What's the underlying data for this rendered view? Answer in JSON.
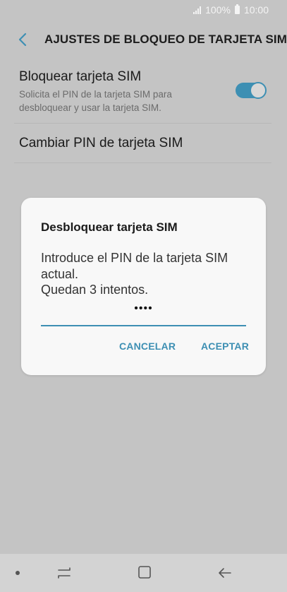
{
  "status_bar": {
    "battery": "100%",
    "time": "10:00",
    "icons": [
      "signal-icon",
      "battery-icon"
    ]
  },
  "header": {
    "back_icon": "chevron-left-icon",
    "title": "AJUSTES DE BLOQUEO DE TARJETA SIM"
  },
  "settings": {
    "lock_sim": {
      "title": "Bloquear tarjeta SIM",
      "subtitle": "Solicita el PIN de la tarjeta SIM para desbloquear y usar la tarjeta SIM.",
      "toggle_on": true
    },
    "change_pin": {
      "title": "Cambiar PIN de tarjeta SIM"
    }
  },
  "dialog": {
    "title": "Desbloquear tarjeta SIM",
    "message_line1": "Introduce el PIN de la tarjeta SIM actual.",
    "message_line2": "Quedan 3 intentos.",
    "pin_value": "••••",
    "cancel_label": "CANCELAR",
    "accept_label": "ACEPTAR"
  },
  "nav_bar": {
    "icons": [
      "nav-dot-icon",
      "recent-apps-icon",
      "home-icon",
      "back-arrow-icon"
    ]
  },
  "colors": {
    "accent": "#3d8fb3",
    "background_dimmed": "#c4c4c4",
    "dialog_bg": "#f8f8f8"
  }
}
